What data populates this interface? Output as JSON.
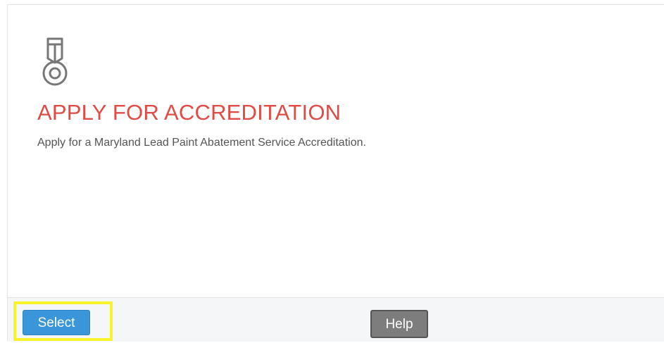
{
  "card": {
    "icon": "medal-icon",
    "title": "APPLY FOR ACCREDITATION",
    "description": "Apply for a Maryland Lead Paint Abatement Service Accreditation."
  },
  "footer": {
    "select_label": "Select",
    "help_label": "Help"
  },
  "colors": {
    "title": "#e04b45",
    "select_button": "#3a96d8",
    "help_button": "#7d7d7d",
    "highlight": "#f7f22a"
  }
}
